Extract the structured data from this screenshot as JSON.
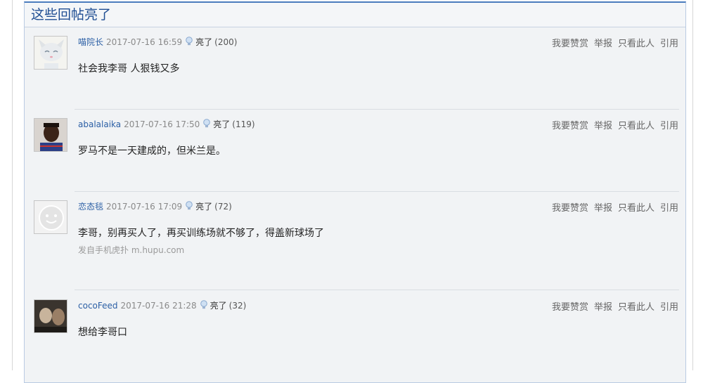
{
  "panel": {
    "title": "这些回帖亮了"
  },
  "posts": [
    {
      "author": "喵院长",
      "time": "2017-07-16 16:59",
      "light_label": "亮了",
      "light_count": "(200)",
      "content": "社会我李哥 人狠钱又多",
      "source": ""
    },
    {
      "author": "abalalaika",
      "time": "2017-07-16 17:50",
      "light_label": "亮了",
      "light_count": "(119)",
      "content": "罗马不是一天建成的，但米兰是。",
      "source": ""
    },
    {
      "author": "恋态毯",
      "time": "2017-07-16 17:09",
      "light_label": "亮了",
      "light_count": "(72)",
      "content": "李哥，别再买人了，再买训练场就不够了，得盖新球场了",
      "source": "发自手机虎扑 m.hupu.com"
    },
    {
      "author": "cocoFeed",
      "time": "2017-07-16 21:28",
      "light_label": "亮了",
      "light_count": "(32)",
      "content": "想给李哥口",
      "source": ""
    }
  ],
  "actions": {
    "praise": "我要赞赏",
    "report": "举报",
    "only_author": "只看此人",
    "quote": "引用"
  },
  "icons": {
    "light": "lightbulb-icon"
  }
}
